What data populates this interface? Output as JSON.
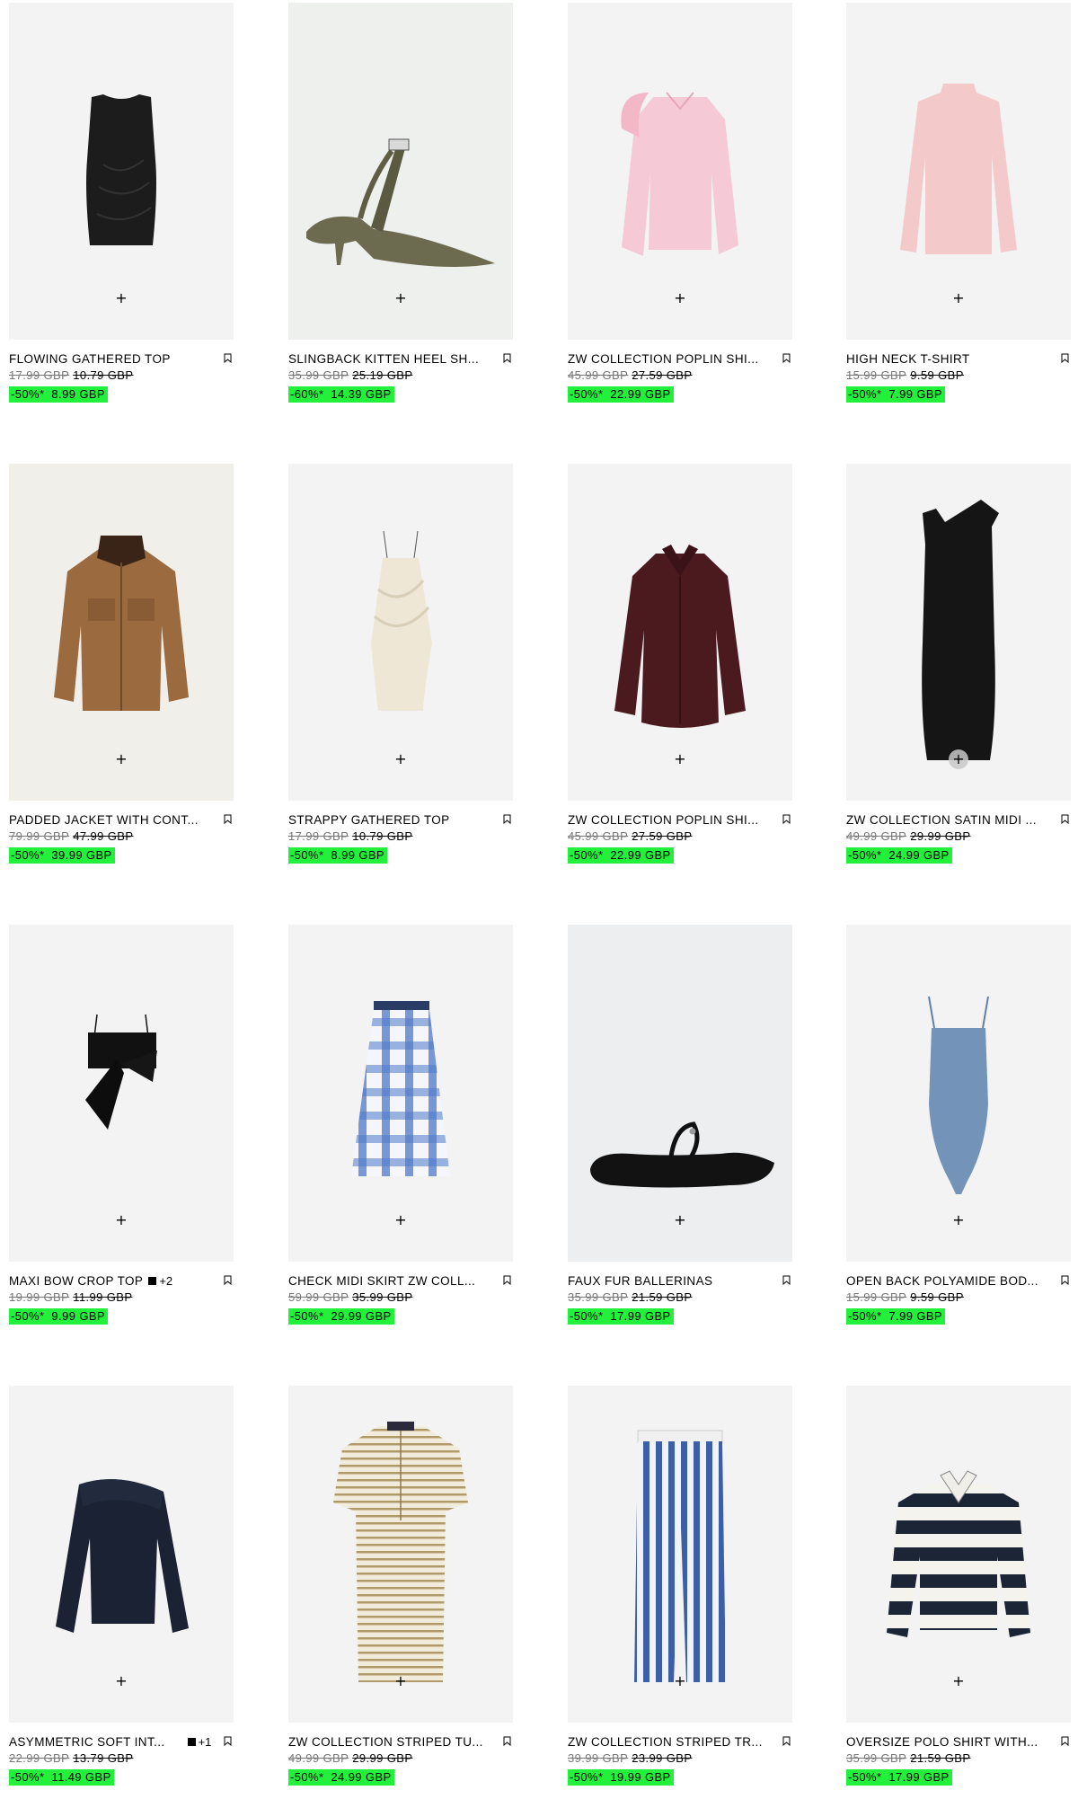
{
  "colors": {
    "sale_badge": "#22f03a",
    "image_bg": "#f3f3f3"
  },
  "icons": {
    "add": "plus-icon",
    "save": "bookmark-icon"
  },
  "add_symbol": "+",
  "products": [
    {
      "name": "FLOWING GATHERED TOP",
      "old_price": "17.99 GBP",
      "price": "10.79 GBP",
      "discount": "-50%*",
      "sale_price": "8.99 GBP"
    },
    {
      "name": "SLINGBACK KITTEN HEEL SH...",
      "old_price": "35.99 GBP",
      "price": "25.19 GBP",
      "discount": "-60%*",
      "sale_price": "14.39 GBP"
    },
    {
      "name": "ZW COLLECTION POPLIN SHI...",
      "old_price": "45.99 GBP",
      "price": "27.59 GBP",
      "discount": "-50%*",
      "sale_price": "22.99 GBP"
    },
    {
      "name": "HIGH NECK T-SHIRT",
      "old_price": "15.99 GBP",
      "price": "9.59 GBP",
      "discount": "-50%*",
      "sale_price": "7.99 GBP"
    },
    {
      "name": "PADDED JACKET WITH CONT...",
      "old_price": "79.99 GBP",
      "price": "47.99 GBP",
      "discount": "-50%*",
      "sale_price": "39.99 GBP"
    },
    {
      "name": "STRAPPY GATHERED TOP",
      "old_price": "17.99 GBP",
      "price": "10.79 GBP",
      "discount": "-50%*",
      "sale_price": "8.99 GBP"
    },
    {
      "name": "ZW COLLECTION POPLIN SHI...",
      "old_price": "45.99 GBP",
      "price": "27.59 GBP",
      "discount": "-50%*",
      "sale_price": "22.99 GBP"
    },
    {
      "name": "ZW COLLECTION SATIN MIDI ...",
      "old_price": "49.99 GBP",
      "price": "29.99 GBP",
      "discount": "-50%*",
      "sale_price": "24.99 GBP"
    },
    {
      "name": "MAXI BOW CROP TOP",
      "extra_colors": "+2",
      "old_price": "19.99 GBP",
      "price": "11.99 GBP",
      "discount": "-50%*",
      "sale_price": "9.99 GBP"
    },
    {
      "name": "CHECK MIDI SKIRT ZW COLL...",
      "old_price": "59.99 GBP",
      "price": "35.99 GBP",
      "discount": "-50%*",
      "sale_price": "29.99 GBP"
    },
    {
      "name": "FAUX FUR BALLERINAS",
      "old_price": "35.99 GBP",
      "price": "21.59 GBP",
      "discount": "-50%*",
      "sale_price": "17.99 GBP"
    },
    {
      "name": "OPEN BACK POLYAMIDE BOD...",
      "old_price": "15.99 GBP",
      "price": "9.59 GBP",
      "discount": "-50%*",
      "sale_price": "7.99 GBP"
    },
    {
      "name": "ASYMMETRIC SOFT INT...",
      "extra_colors": "+1",
      "old_price": "22.99 GBP",
      "price": "13.79 GBP",
      "discount": "-50%*",
      "sale_price": "11.49 GBP"
    },
    {
      "name": "ZW COLLECTION STRIPED TU...",
      "old_price": "49.99 GBP",
      "price": "29.99 GBP",
      "discount": "-50%*",
      "sale_price": "24.99 GBP"
    },
    {
      "name": "ZW COLLECTION STRIPED TR...",
      "old_price": "39.99 GBP",
      "price": "23.99 GBP",
      "discount": "-50%*",
      "sale_price": "19.99 GBP"
    },
    {
      "name": "OVERSIZE POLO SHIRT WITH...",
      "old_price": "35.99 GBP",
      "price": "21.59 GBP",
      "discount": "-50%*",
      "sale_price": "17.99 GBP"
    }
  ]
}
